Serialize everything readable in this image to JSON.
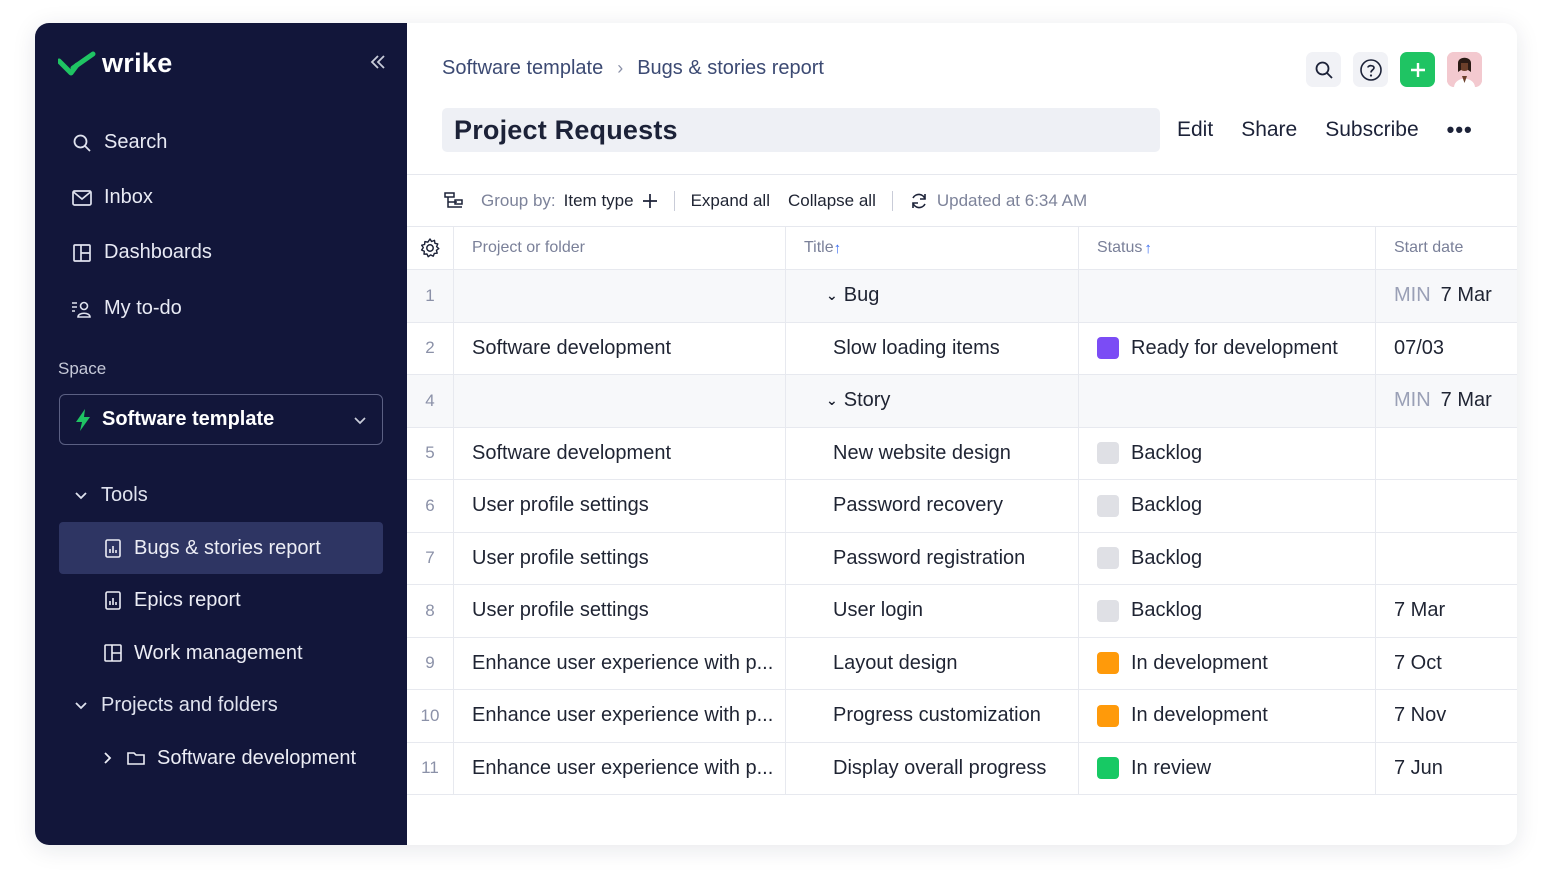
{
  "app": {
    "logo": "wrike"
  },
  "sidebar": {
    "nav": [
      {
        "label": "Search",
        "icon": "search-icon"
      },
      {
        "label": "Inbox",
        "icon": "inbox-icon"
      },
      {
        "label": "Dashboards",
        "icon": "dashboard-icon"
      },
      {
        "label": "My to-do",
        "icon": "todo-icon"
      }
    ],
    "space_label": "Space",
    "space_name": "Software template",
    "tools_label": "Tools",
    "tools": [
      {
        "label": "Bugs & stories report",
        "icon": "report-icon",
        "active": true
      },
      {
        "label": "Epics report",
        "icon": "report-icon",
        "active": false
      },
      {
        "label": "Work management",
        "icon": "dashboard-icon",
        "active": false
      }
    ],
    "projects_label": "Projects and folders",
    "projects": [
      {
        "label": "Software development",
        "icon": "folder-icon"
      }
    ]
  },
  "breadcrumb": [
    "Software template",
    "Bugs & stories report"
  ],
  "title": "Project Requests",
  "actions": {
    "edit": "Edit",
    "share": "Share",
    "subscribe": "Subscribe",
    "more": "•••"
  },
  "toolbar": {
    "group_by_label": "Group by:",
    "group_by_value": "Item type",
    "expand": "Expand all",
    "collapse": "Collapse all",
    "updated": "Updated at 6:34 AM"
  },
  "table": {
    "columns": [
      "Project or folder",
      "Title",
      "Status",
      "Start date"
    ],
    "rows": [
      {
        "num": "1",
        "group": true,
        "title": "Bug",
        "min": "MIN",
        "date": "7 Mar"
      },
      {
        "num": "2",
        "project": "Software development",
        "title": "Slow loading items",
        "status": "Ready for development",
        "color": "#7b4cf5",
        "date": "07/03"
      },
      {
        "num": "4",
        "group": true,
        "title": "Story",
        "min": "MIN",
        "date": "7 Mar"
      },
      {
        "num": "5",
        "project": "Software development",
        "title": "New website design",
        "status": "Backlog",
        "color": "#dfe0e5",
        "date": ""
      },
      {
        "num": "6",
        "project": "User profile settings",
        "title": "Password recovery",
        "status": "Backlog",
        "color": "#dfe0e5",
        "date": ""
      },
      {
        "num": "7",
        "project": "User profile settings",
        "title": "Password registration",
        "status": "Backlog",
        "color": "#dfe0e5",
        "date": ""
      },
      {
        "num": "8",
        "project": "User profile settings",
        "title": "User login",
        "status": "Backlog",
        "color": "#dfe0e5",
        "date": "7 Mar"
      },
      {
        "num": "9",
        "project": "Enhance user experience with p...",
        "title": "Layout design",
        "status": "In development",
        "color": "#ff9a0a",
        "date": "7 Oct"
      },
      {
        "num": "10",
        "project": "Enhance user experience with p...",
        "title": "Progress customization",
        "status": "In development",
        "color": "#ff9a0a",
        "date": "7 Nov"
      },
      {
        "num": "11",
        "project": "Enhance user experience with p...",
        "title": "Display overall progress",
        "status": "In review",
        "color": "#17c964",
        "date": "7 Jun"
      }
    ]
  }
}
